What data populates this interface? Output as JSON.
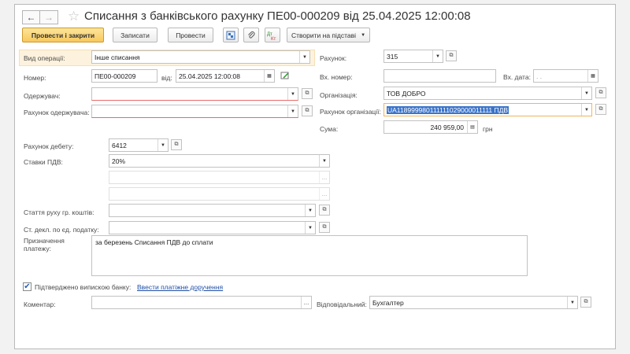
{
  "window": {
    "title": "Списання з банківського рахунку ПЕ00-000209 від 25.04.2025 12:00:08",
    "nav_back": "←",
    "nav_forward": "→"
  },
  "toolbar": {
    "post_close": "Провести і закрити",
    "save": "Записати",
    "post": "Провести",
    "create_based": "Створити на підставі"
  },
  "left": {
    "operation_label": "Вид операції:",
    "operation_value": "Інше списання",
    "number_label": "Номер:",
    "number_value": "ПЕ00-000209",
    "date_label": "від:",
    "date_value": "25.04.2025 12:00:08",
    "recipient_label": "Одержувач:",
    "recipient_value": "",
    "recipient_account_label": "Рахунок одержувача:",
    "recipient_account_value": "",
    "debit_account_label": "Рахунок дебету:",
    "debit_account_value": "6412",
    "vat_label": "Ставки ПДВ:",
    "vat_value": "20%",
    "cashflow_label": "Стаття руху гр. коштів:",
    "tax_decl_label": "Ст. декл. по єд. податку:",
    "purpose_label": "Призначення платежу:",
    "purpose_value": "за березень Списання ПДВ до сплати",
    "confirmed_label": "Підтверджено випискою банку:",
    "confirmed_checked": true,
    "enter_payment_link": "Ввести платіжне доручення",
    "comment_label": "Коментар:",
    "comment_value": ""
  },
  "right": {
    "account_label": "Рахунок:",
    "account_value": "315",
    "in_number_label": "Вх. номер:",
    "in_number_value": "",
    "in_date_label": "Вх. дата:",
    "in_date_value": ". .",
    "organization_label": "Організація:",
    "organization_value": "ТОВ ДОБРО",
    "org_account_label": "Рахунок організації:",
    "org_account_value": "UA118999980111111029000011111 ПДВ",
    "sum_label": "Сума:",
    "sum_value": "240 959,00",
    "currency": "грн",
    "responsible_label": "Відповідальний:",
    "responsible_value": "Бухгалтер"
  },
  "colors": {
    "primary_button": "#f7c85b",
    "selection": "#3a73c9",
    "link": "#1f4fa8",
    "operation_highlight": "#fdf2dd"
  }
}
